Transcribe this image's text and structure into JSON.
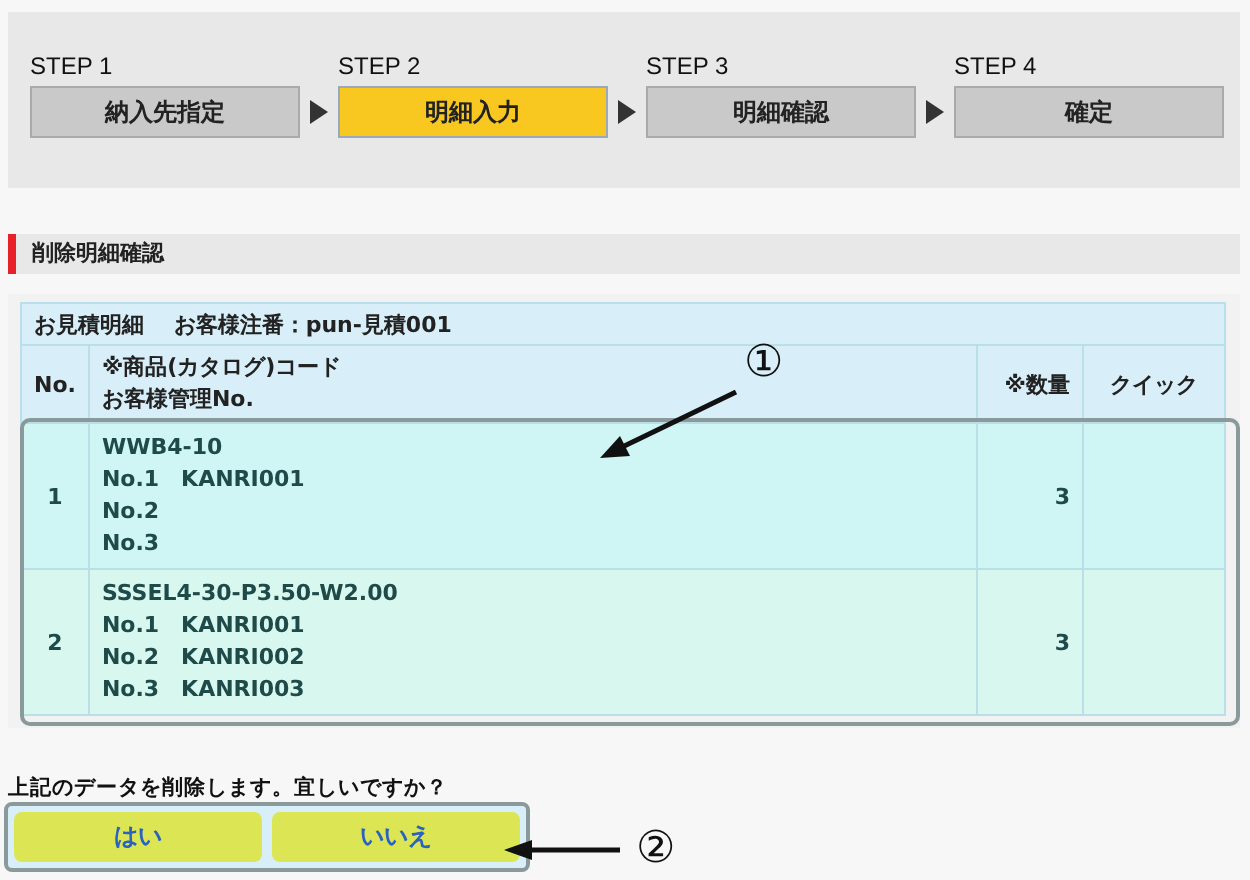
{
  "steps": [
    {
      "label": "STEP 1",
      "name": "納入先指定",
      "selected": false
    },
    {
      "label": "STEP 2",
      "name": "明細入力",
      "selected": true
    },
    {
      "label": "STEP 3",
      "name": "明細確認",
      "selected": false
    },
    {
      "label": "STEP 4",
      "name": "確定",
      "selected": false
    }
  ],
  "section_title": "削除明細確認",
  "table": {
    "caption": "お見積明細　 お客様注番：pun-見積001",
    "columns": [
      "No.",
      [
        "※商品(カタログ)コード",
        "お客様管理No."
      ],
      "※数量",
      "クイック"
    ],
    "rows": [
      {
        "no": "1",
        "code": "WWB4-10",
        "refs": [
          "No.1　KANRI001",
          "No.2",
          "No.3"
        ],
        "quantity": "3"
      },
      {
        "no": "2",
        "code": "SSSEL4-30-P3.50-W2.00",
        "refs": [
          "No.1　KANRI001",
          "No.2　KANRI002",
          "No.3　KANRI003"
        ],
        "quantity": "3"
      }
    ]
  },
  "question": "上記のデータを削除します。宜しいですか？",
  "buttons": [
    "はい",
    "いいえ"
  ],
  "annotations": [
    "①",
    "②"
  ]
}
